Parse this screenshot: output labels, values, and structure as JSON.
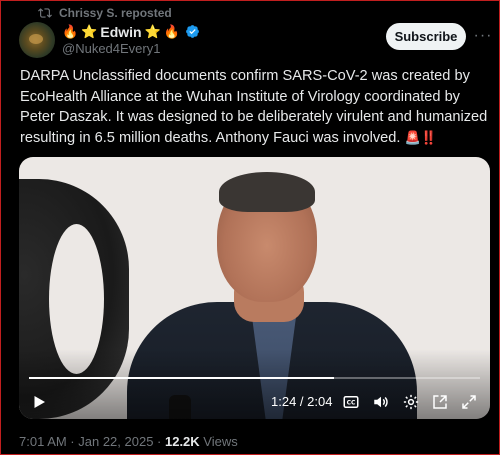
{
  "repost": {
    "icon": "repost-icon",
    "label": "Chrissy S. reposted"
  },
  "author": {
    "name": "Edwin",
    "emoji_left": [
      "🔥",
      "⭐"
    ],
    "emoji_right": [
      "⭐",
      "🔥"
    ],
    "handle": "@Nuked4Every1",
    "verified_icon": "verified-badge-icon"
  },
  "actions": {
    "subscribe_label": "Subscribe",
    "more_label": "···"
  },
  "tweet": {
    "text": "DARPA Unclassified documents confirm SARS-CoV-2 was created by EcoHealth Alliance at the Wuhan Institute of Virology coordinated by Peter Daszak. It was designed to be deliberately virulent and humanized resulting in 6.5 million deaths. Anthony Fauci was involved.",
    "tail_emoji": "🚨‼️"
  },
  "video": {
    "time": "1:24 / 2:04",
    "progress": 0.677,
    "controls": [
      "play-icon",
      "captions-icon",
      "volume-icon",
      "settings-icon",
      "pip-icon",
      "fullscreen-icon"
    ]
  },
  "meta": {
    "timestamp": "7:01 AM · Jan 22, 2025 · ",
    "views_count": "12.2K",
    "views_label": " Views"
  },
  "colors": {
    "background": "#000000",
    "muted": "#71767b",
    "text": "#e7e9ea",
    "verified": "#1d9bf0",
    "frame": "#c11f1f"
  }
}
